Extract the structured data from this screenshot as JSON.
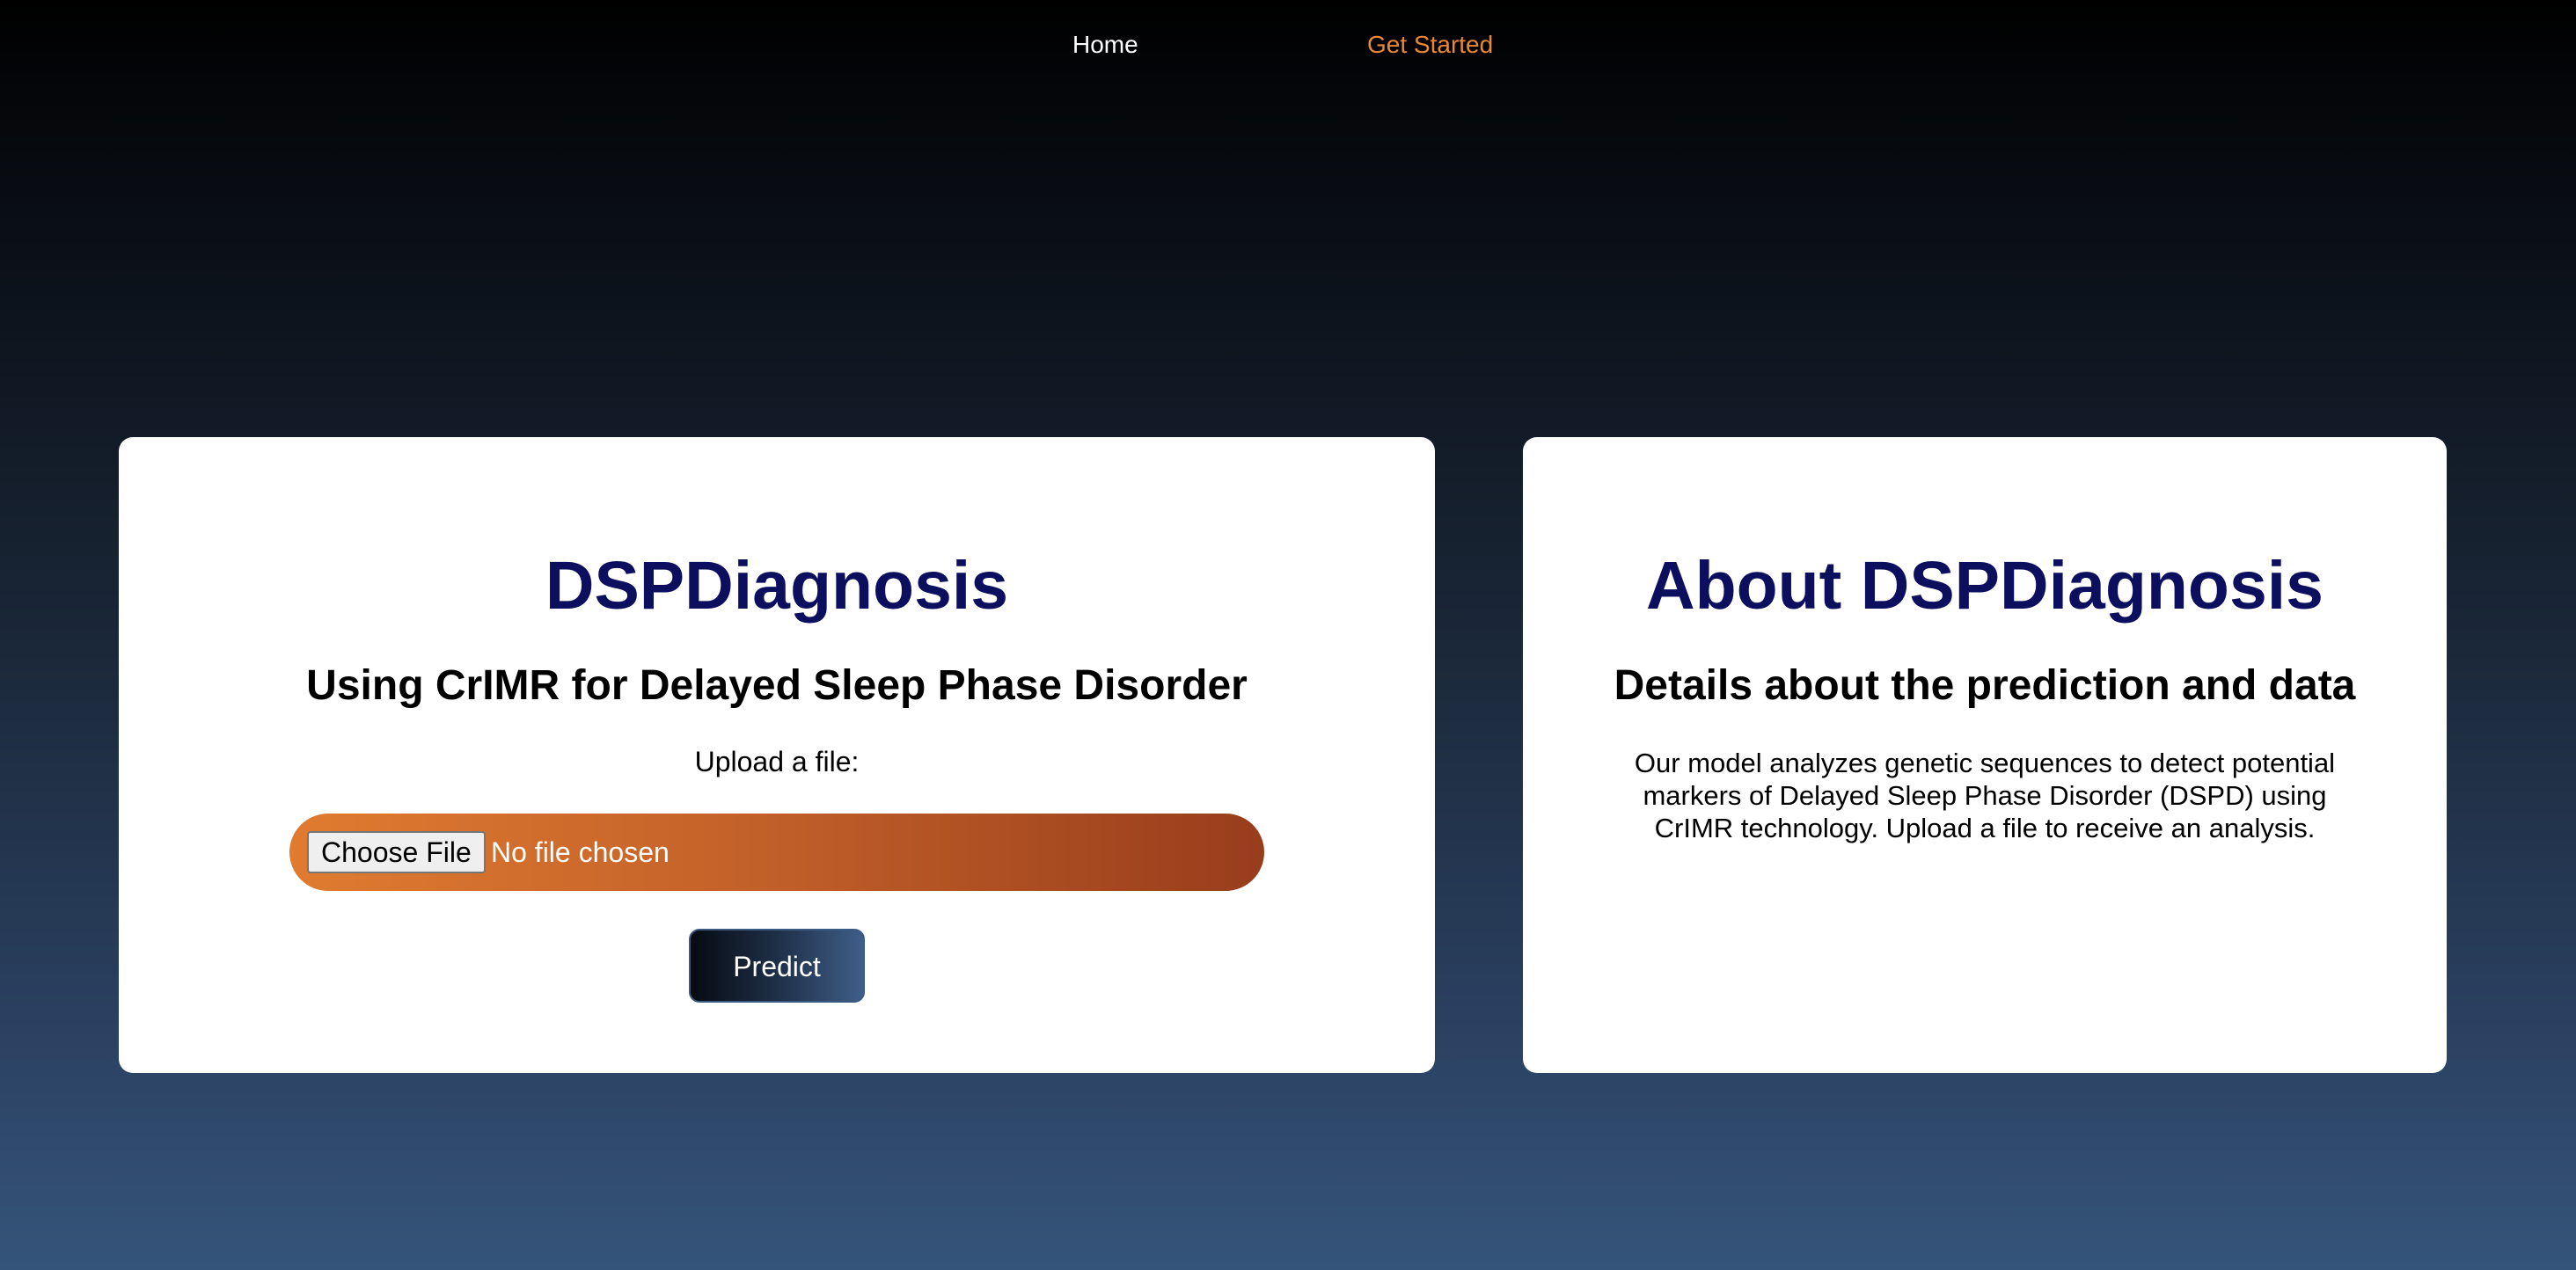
{
  "nav": {
    "home_label": "Home",
    "get_started_label": "Get Started"
  },
  "diagnosis_card": {
    "title": "DSPDiagnosis",
    "subtitle": "Using CrIMR for Delayed Sleep Phase Disorder",
    "upload_label": "Upload a file:",
    "choose_file_label": "Choose File",
    "file_status": "No file chosen",
    "predict_label": "Predict"
  },
  "about_card": {
    "title": "About DSPDiagnosis",
    "subtitle": "Details about the prediction and data",
    "description": "Our model analyzes genetic sequences to detect potential markers of Delayed Sleep Phase Disorder (DSPD) using CrIMR technology. Upload a file to receive an analysis."
  },
  "colors": {
    "title": "#0c0f5e",
    "nav_active": "#e98834",
    "file_bar_start": "#e07b30",
    "file_bar_end": "#983d1c"
  }
}
